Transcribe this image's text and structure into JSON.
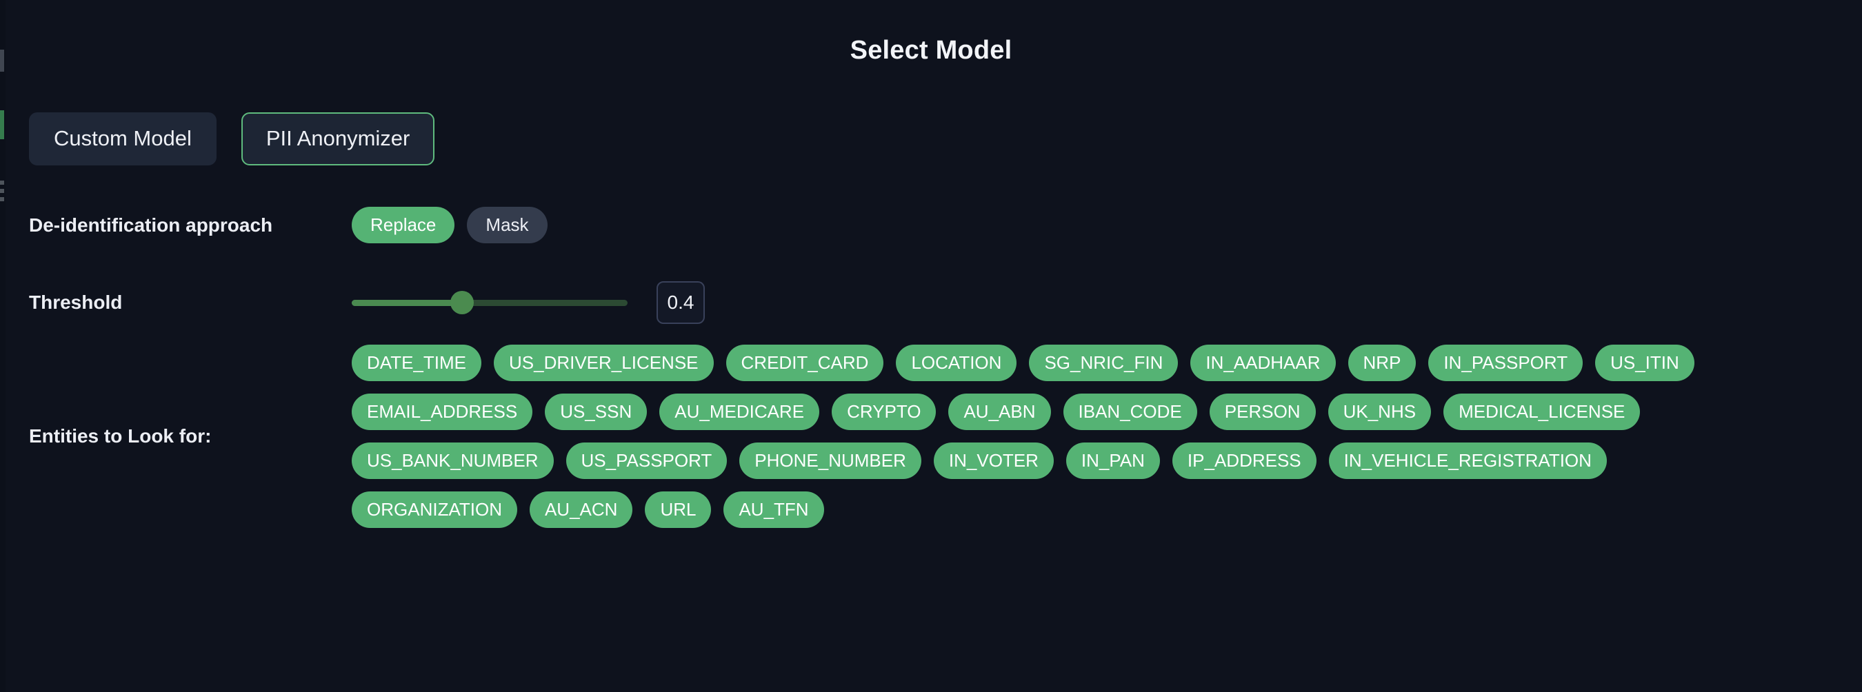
{
  "header": {
    "title": "Select Model"
  },
  "model_tabs": [
    {
      "label": "Custom Model",
      "selected": false
    },
    {
      "label": "PII Anonymizer",
      "selected": true
    }
  ],
  "deidentification": {
    "label": "De-identification approach",
    "options": [
      {
        "label": "Replace",
        "selected": true
      },
      {
        "label": "Mask",
        "selected": false
      }
    ]
  },
  "threshold": {
    "label": "Threshold",
    "value": "0.4",
    "percent": 40
  },
  "entities": {
    "label": "Entities to Look for:",
    "rows": [
      [
        "DATE_TIME",
        "US_DRIVER_LICENSE",
        "CREDIT_CARD",
        "LOCATION",
        "SG_NRIC_FIN",
        "IN_AADHAAR",
        "NRP",
        "IN_PASSPORT",
        "US_ITIN"
      ],
      [
        "EMAIL_ADDRESS",
        "US_SSN",
        "AU_MEDICARE",
        "CRYPTO",
        "AU_ABN",
        "IBAN_CODE",
        "PERSON",
        "UK_NHS",
        "MEDICAL_LICENSE"
      ],
      [
        "US_BANK_NUMBER",
        "US_PASSPORT",
        "PHONE_NUMBER",
        "IN_VOTER",
        "IN_PAN",
        "IP_ADDRESS",
        "IN_VEHICLE_REGISTRATION"
      ],
      [
        "ORGANIZATION",
        "AU_ACN",
        "URL",
        "AU_TFN"
      ]
    ]
  },
  "colors": {
    "background": "#0e121d",
    "accent_green": "#55b374",
    "tab_active_border": "#5fbb7e",
    "tab_background": "#1f2737",
    "pill_inactive": "#343c4d",
    "slider_fill": "#4a8a50",
    "slider_track": "#2c4a33",
    "text_primary": "#eceef4"
  }
}
